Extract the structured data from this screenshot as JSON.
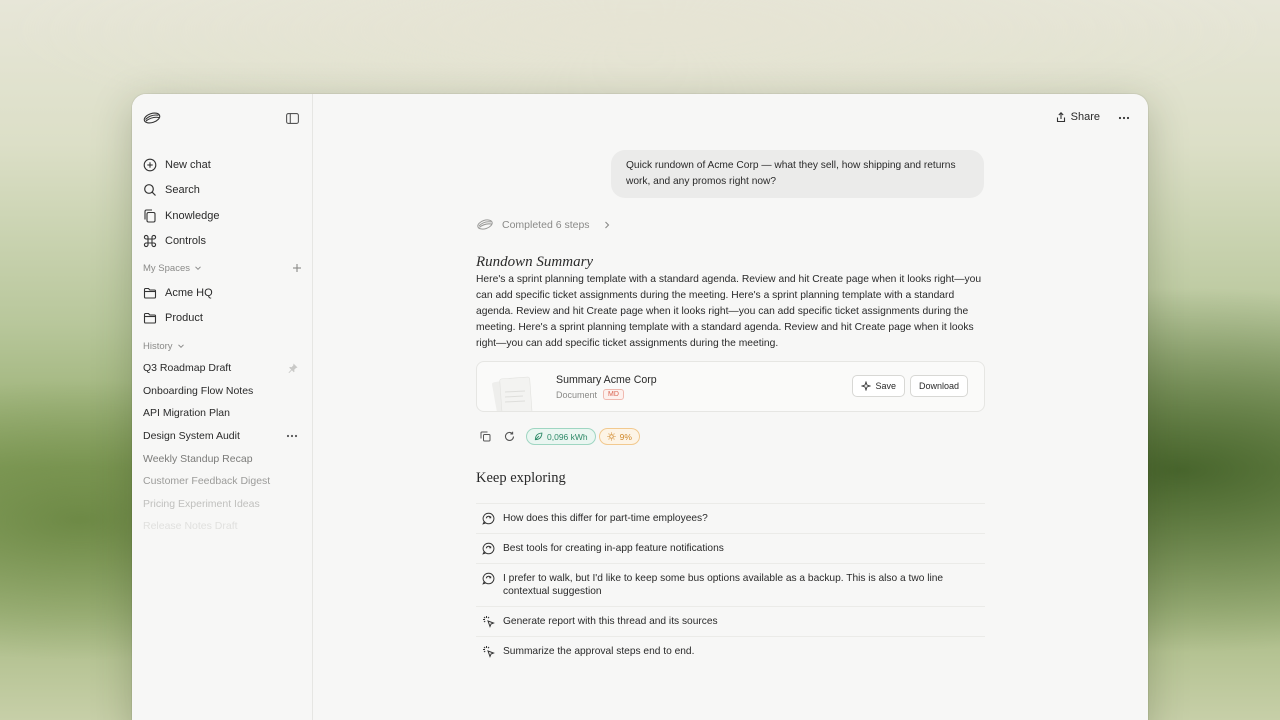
{
  "sidebar": {
    "nav": [
      {
        "label": "New chat",
        "icon": "plus-circle-icon"
      },
      {
        "label": "Search",
        "icon": "search-icon"
      },
      {
        "label": "Knowledge",
        "icon": "copy-icon"
      },
      {
        "label": "Controls",
        "icon": "command-icon"
      }
    ],
    "spaces_label": "My Spaces",
    "spaces": [
      {
        "label": "Acme HQ",
        "icon": "folder-icon"
      },
      {
        "label": "Product",
        "icon": "folder-icon"
      }
    ],
    "history_label": "History",
    "history": [
      "Q3 Roadmap Draft",
      "Onboarding Flow Notes",
      "API Migration Plan",
      "Design System Audit",
      "Weekly Standup Recap",
      "Customer Feedback Digest",
      "Pricing Experiment Ideas",
      "Release Notes Draft"
    ]
  },
  "topbar": {
    "share_label": "Share",
    "more_label": "···"
  },
  "chat": {
    "user_message": "Quick rundown of Acme Corp — what they sell, how shipping and returns work, and any promos right now?",
    "steps_label": "Completed 6 steps",
    "heading": "Rundown Summary",
    "paragraph": "Here's a sprint planning template with a standard agenda. Review and hit Create page when it looks right—you can add specific ticket assignments during the meeting. Here's a sprint planning template with a standard agenda. Review and hit Create page when it looks right—you can add specific ticket assignments during the meeting. Here's a sprint planning template with a standard agenda. Review and hit Create page when it looks right—you can add specific ticket assignments during the meeting.",
    "document": {
      "title": "Summary Acme Corp",
      "type": "Document",
      "badge": "MD",
      "save_label": "Save",
      "download_label": "Download"
    },
    "energy": "0,096 kWh",
    "percent": "9%"
  },
  "explore": {
    "heading": "Keep exploring",
    "suggestions": [
      {
        "text": "How does this differ for part-time employees?",
        "icon": "chat-refresh-icon"
      },
      {
        "text": "Best tools for creating in-app feature notifications",
        "icon": "chat-refresh-icon"
      },
      {
        "text": "I prefer to walk, but I'd like to keep some bus options available as a backup. This is also a two line contextual suggestion",
        "icon": "chat-refresh-icon"
      },
      {
        "text": "Generate report with this thread and its sources",
        "icon": "sparkle-click-icon"
      },
      {
        "text": "Summarize the approval steps end to end.",
        "icon": "sparkle-click-icon"
      }
    ]
  },
  "colors": {
    "accent_green": "#2e8a68",
    "accent_orange": "#d0882a",
    "badge_red": "#d9624f"
  }
}
